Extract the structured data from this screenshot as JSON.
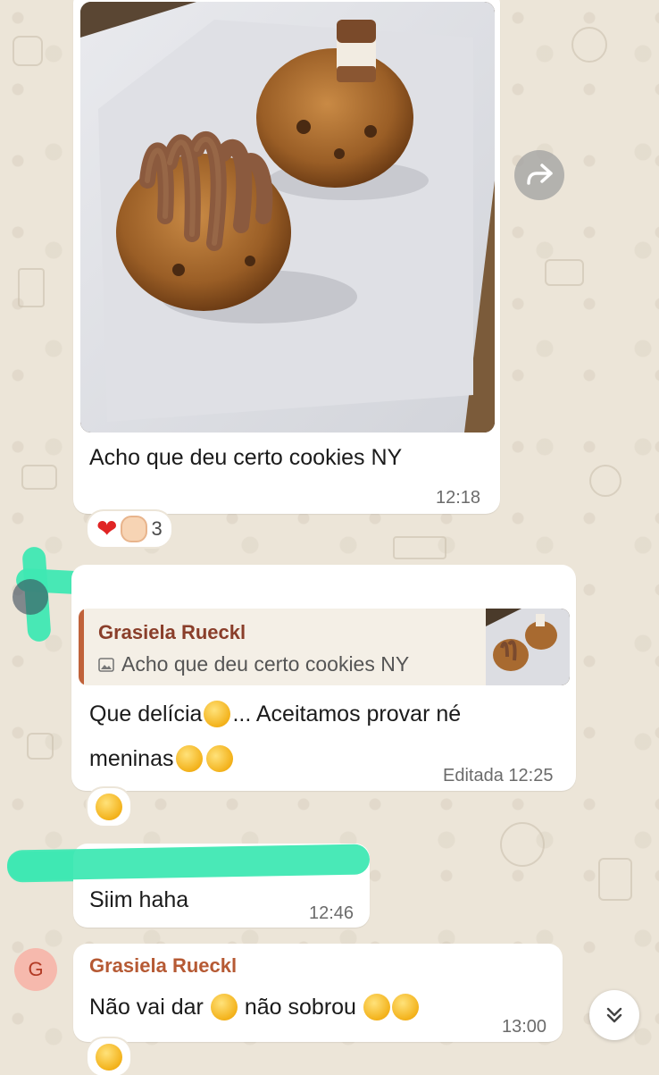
{
  "messages": [
    {
      "caption": "Acho que deu certo cookies NY",
      "time": "12:18",
      "reactions": {
        "emojis": [
          "red-heart",
          "clapping-hands"
        ],
        "count": "3"
      }
    },
    {
      "reply": {
        "quoted_name": "Grasiela Rueckl",
        "quoted_text": "Acho que deu certo cookies NY"
      },
      "text_line1": "Que delícia",
      "text_line1_after": "... Aceitamos provar né",
      "text_line2": "meninas",
      "edited_time": "Editada 12:25",
      "reactions": {
        "emojis": [
          "hand-over-mouth-face"
        ]
      }
    },
    {
      "text": "Siim haha",
      "time": "12:46"
    },
    {
      "sender": "Grasiela Rueckl",
      "avatar_letter": "G",
      "text_part1": "Não vai dar",
      "text_part2": "não sobrou",
      "time": "13:00"
    }
  ],
  "colors": {
    "wallpaper": "#ece5d8",
    "bubble": "#ffffff",
    "sender_name": "#b65a34",
    "redaction": "#3fe8b3"
  },
  "icons": [
    "forward-icon",
    "image-icon",
    "chevron-double-down-icon"
  ]
}
